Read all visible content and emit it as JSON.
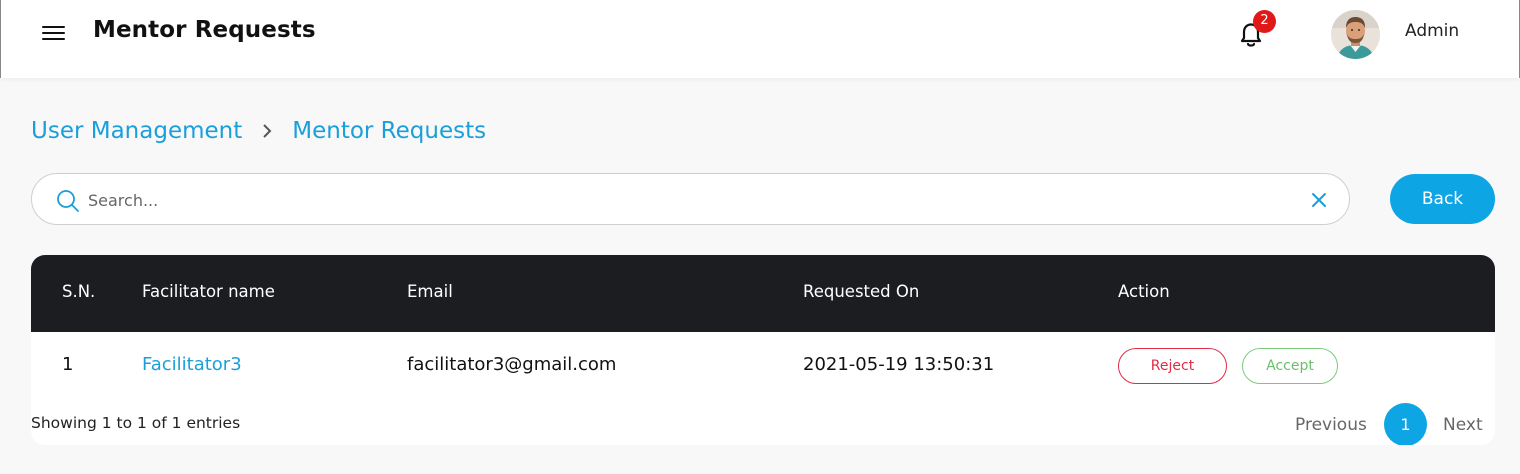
{
  "header": {
    "title": "Mentor Requests",
    "notification_count": "2",
    "user_name": "Admin"
  },
  "breadcrumb": {
    "items": [
      "User Management",
      "Mentor Requests"
    ]
  },
  "search": {
    "placeholder": "Search...",
    "value": ""
  },
  "back_button": {
    "label": "Back"
  },
  "table": {
    "columns": [
      "S.N.",
      "Facilitator name",
      "Email",
      "Requested On",
      "Action"
    ],
    "rows": [
      {
        "sn": "1",
        "name": "Facilitator3",
        "email": "facilitator3@gmail.com",
        "requested_on": "2021-05-19 13:50:31",
        "reject_label": "Reject",
        "accept_label": "Accept"
      }
    ]
  },
  "footer": {
    "showing": "Showing 1 to 1 of 1 entries",
    "previous_label": "Previous",
    "current_page": "1",
    "next_label": "Next"
  },
  "colors": {
    "accent": "#0ea5e4",
    "link": "#1a9fdb",
    "table_header_bg": "#1c1d20",
    "reject": "#e02c47",
    "accept": "#6bc06b",
    "badge": "#e11818"
  },
  "icons": [
    "menu-icon",
    "bell-icon",
    "avatar",
    "chevron-right-icon",
    "search-icon",
    "close-icon"
  ]
}
